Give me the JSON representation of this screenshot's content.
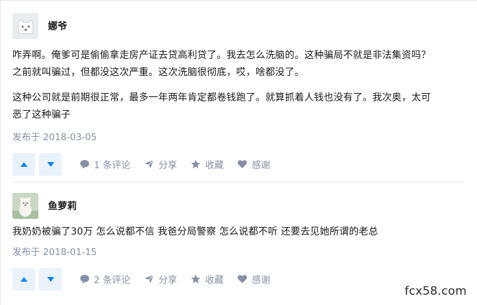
{
  "answers": [
    {
      "author": "娜爷",
      "paragraphs": [
        "咋弄啊。俺爹可是偷偷拿走房产证去贷高利贷了。我去怎么洗脑的。这种骗局不就是非法集资吗？",
        "之前就叫骗过，但都没这次严重。这次洗脑很彻底，哎，啥都没了。",
        "这种公司就是前期很正常，最多一年两年肯定都卷钱跑了。就算抓着人钱也没有了。我次奥，太可",
        "恶了这种骗子"
      ],
      "date": "发布于 2018-03-05",
      "comments": "1 条评论",
      "share": "分享",
      "favorite": "收藏",
      "thanks": "感谢"
    },
    {
      "author": "鱼萝莉",
      "paragraphs": [
        "我奶奶被骗了30万 怎么说都不信 我爸分局警察 怎么说都不听 还要去见她所谓的老总"
      ],
      "date": "发布于 2018-01-15",
      "comments": "2 条评论",
      "share": "分享",
      "favorite": "收藏",
      "thanks": "感谢"
    }
  ],
  "colors": {
    "accent": "#0084ff",
    "muted": "#8590a6",
    "vote_bg": "#eaf2fc"
  },
  "watermark": "fcx58.com"
}
